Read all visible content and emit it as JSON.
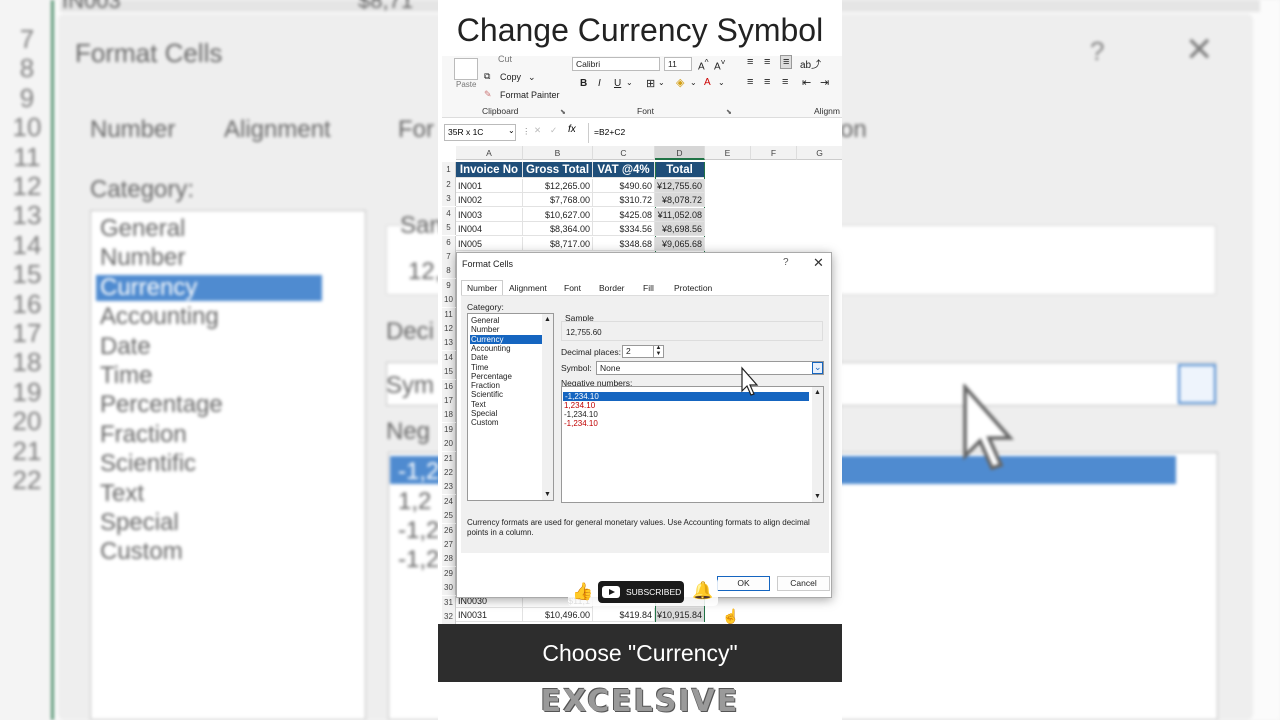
{
  "video_title": "Change Currency Symbol",
  "caption": "Choose \"Currency\"",
  "logo_text": "EXCELSIVE",
  "ribbon": {
    "cut": "Cut",
    "copy": "Copy",
    "format_painter": "Format Painter",
    "paste": "Paste",
    "clipboard_group": "Clipboard",
    "font_group": "Font",
    "alignment_group": "Alignm",
    "font_name": "Calibri",
    "font_size": "11",
    "bold": "B",
    "italic": "I",
    "underline": "U"
  },
  "formula_bar": {
    "name_box": "35R x 1C",
    "fx": "fx",
    "formula": "=B2+C2"
  },
  "sheet": {
    "columns": [
      "A",
      "B",
      "C",
      "D",
      "E",
      "F",
      "G"
    ],
    "headers": [
      "Invoice No",
      "Gross Total",
      "VAT @4%",
      "Total"
    ],
    "rows": [
      {
        "n": "2",
        "inv": "IN001",
        "gross": "$12,265.00",
        "vat": "$490.60",
        "total": "¥12,755.60"
      },
      {
        "n": "3",
        "inv": "IN002",
        "gross": "$7,768.00",
        "vat": "$310.72",
        "total": "¥8,078.72"
      },
      {
        "n": "4",
        "inv": "IN003",
        "gross": "$10,627.00",
        "vat": "$425.08",
        "total": "¥11,052.08"
      },
      {
        "n": "5",
        "inv": "IN004",
        "gross": "$8,364.00",
        "vat": "$334.56",
        "total": "¥8,698.56"
      },
      {
        "n": "6",
        "inv": "IN005",
        "gross": "$8,717.00",
        "vat": "$348.68",
        "total": "¥9,065.68"
      }
    ],
    "bottom_rows": [
      {
        "n": "31",
        "inv": "IN0030",
        "gross": "$11,1",
        "vat": "",
        "total": ""
      },
      {
        "n": "32",
        "inv": "IN0031",
        "gross": "$10,496.00",
        "vat": "$419.84",
        "total": "¥10,915.84"
      }
    ],
    "row_numbers": [
      "1",
      "2",
      "3",
      "4",
      "5",
      "6",
      "7",
      "8",
      "9",
      "10",
      "11",
      "12",
      "13",
      "14",
      "15",
      "16",
      "17",
      "18",
      "19",
      "20",
      "21",
      "22",
      "23",
      "24",
      "25",
      "26",
      "27",
      "28",
      "29",
      "30",
      "31",
      "32"
    ]
  },
  "dialog": {
    "title": "Format Cells",
    "help": "?",
    "close": "✕",
    "tabs": [
      "Number",
      "Alignment",
      "Font",
      "Border",
      "Fill",
      "Protection"
    ],
    "category_label": "Category:",
    "categories": [
      "General",
      "Number",
      "Currency",
      "Accounting",
      "Date",
      "Time",
      "Percentage",
      "Fraction",
      "Scientific",
      "Text",
      "Special",
      "Custom"
    ],
    "selected_category": "Currency",
    "sample_label": "Sample",
    "sample_value": "12,755.60",
    "decimal_label": "Decimal places:",
    "decimal_value": "2",
    "symbol_label": "Symbol:",
    "symbol_value": "None",
    "negative_label": "Negative numbers:",
    "negative_options": [
      "-1,234.10",
      "1,234.10",
      "-1,234.10",
      "-1,234.10"
    ],
    "description": "Currency formats are used for general monetary values.  Use Accounting formats to align decimal points in a column.",
    "ok": "OK",
    "cancel": "Cancel"
  },
  "subscribe": {
    "label": "SUBSCRIBED"
  },
  "background": {
    "title": "Format Cells",
    "tabs": [
      "Number",
      "Alignment",
      "For",
      "on"
    ],
    "category_label": "Category:",
    "categories": [
      "General",
      "Number",
      "Currency",
      "Accounting",
      "Date",
      "Time",
      "Percentage",
      "Fraction",
      "Scientific",
      "Text",
      "Special",
      "Custom"
    ],
    "labels": [
      "San",
      "12,",
      "Deci",
      "Sym",
      "Neg"
    ],
    "neg_values": [
      "-1,2",
      "1,2",
      "-1,2",
      "-1,2"
    ],
    "top_left": "IN003",
    "top_mid": "$8,71",
    "row_numbers": [
      "7",
      "8",
      "9",
      "10",
      "11",
      "12",
      "13",
      "14",
      "15",
      "16",
      "17",
      "18",
      "19",
      "20",
      "21",
      "22"
    ]
  },
  "colors": {
    "header_blue": "#1f4e79",
    "selection_blue": "#1565c0",
    "excel_green": "#217346",
    "negative_red": "#c00000"
  }
}
